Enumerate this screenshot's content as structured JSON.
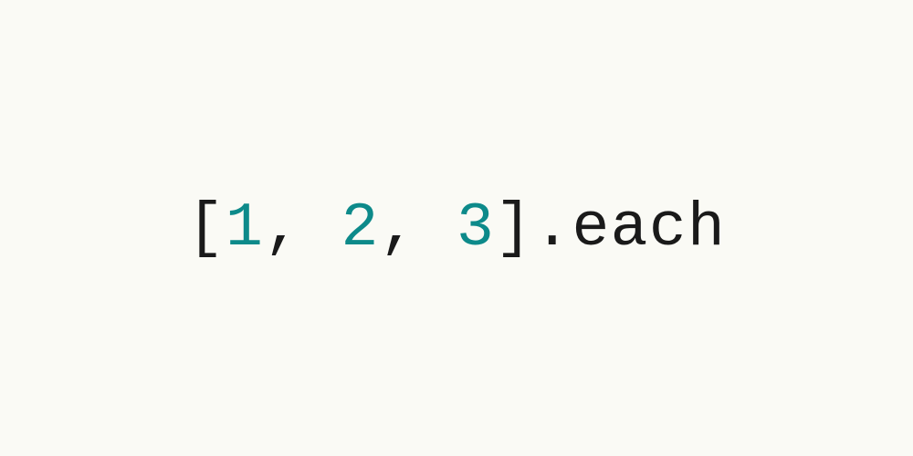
{
  "code": {
    "open_bracket": "[",
    "num1": "1",
    "comma1": ",",
    "space1": " ",
    "num2": "2",
    "comma2": ",",
    "space2": " ",
    "num3": "3",
    "close_bracket": "]",
    "method": ".each"
  }
}
